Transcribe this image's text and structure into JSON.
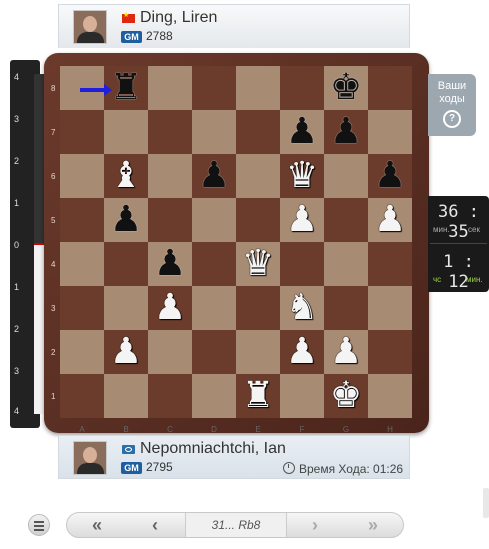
{
  "top_player": {
    "name": "Ding, Liren",
    "title": "GM",
    "rating": "2788",
    "flag": "china-flag-icon"
  },
  "bottom_player": {
    "name": "Nepomniachtchi, Ian",
    "title": "GM",
    "rating": "2795",
    "flag": "fide-flag-icon",
    "move_time_label": "Время Хода: 01:26"
  },
  "your_move": {
    "label_line1": "Ваши",
    "label_line2": "ходы",
    "help": "?"
  },
  "clocks": {
    "top_time": "36 : 35",
    "top_min": "мин.",
    "top_sec": "сек",
    "bottom_time": "1 : 12",
    "bottom_h": "чс",
    "bottom_min": "мин."
  },
  "eval_bar": {
    "labels_top": [
      "4",
      "3",
      "2",
      "1",
      "0"
    ],
    "labels_bottom": [
      "1",
      "2",
      "3",
      "4"
    ],
    "value": 0
  },
  "board": {
    "ranks": [
      "8",
      "7",
      "6",
      "5",
      "4",
      "3",
      "2",
      "1"
    ],
    "files": [
      "A",
      "B",
      "C",
      "D",
      "E",
      "F",
      "G",
      "H"
    ],
    "pieces": [
      {
        "sq": "b8",
        "glyph": "♜",
        "color": "b"
      },
      {
        "sq": "g8",
        "glyph": "♚",
        "color": "b"
      },
      {
        "sq": "f7",
        "glyph": "♟",
        "color": "b"
      },
      {
        "sq": "g7",
        "glyph": "♟",
        "color": "b"
      },
      {
        "sq": "b6",
        "glyph": "♝",
        "color": "w"
      },
      {
        "sq": "d6",
        "glyph": "♟",
        "color": "b"
      },
      {
        "sq": "f6",
        "glyph": "♛",
        "color": "w"
      },
      {
        "sq": "h6",
        "glyph": "♟",
        "color": "b"
      },
      {
        "sq": "b5",
        "glyph": "♟",
        "color": "b"
      },
      {
        "sq": "f5",
        "glyph": "♟",
        "color": "w"
      },
      {
        "sq": "h5",
        "glyph": "♟",
        "color": "w"
      },
      {
        "sq": "c4",
        "glyph": "♟",
        "color": "b"
      },
      {
        "sq": "e4",
        "glyph": "♛",
        "color": "w"
      },
      {
        "sq": "c3",
        "glyph": "♟",
        "color": "w"
      },
      {
        "sq": "f3",
        "glyph": "♞",
        "color": "w"
      },
      {
        "sq": "b2",
        "glyph": "♟",
        "color": "w"
      },
      {
        "sq": "f2",
        "glyph": "♟",
        "color": "w"
      },
      {
        "sq": "g2",
        "glyph": "♟",
        "color": "w"
      },
      {
        "sq": "e1",
        "glyph": "♜",
        "color": "w"
      },
      {
        "sq": "g1",
        "glyph": "♚",
        "color": "w"
      }
    ],
    "last_move_arrow_to": "b8"
  },
  "nav": {
    "first": "«",
    "prev": "‹",
    "move": "31... Rb8",
    "next": "›",
    "last": "»"
  }
}
